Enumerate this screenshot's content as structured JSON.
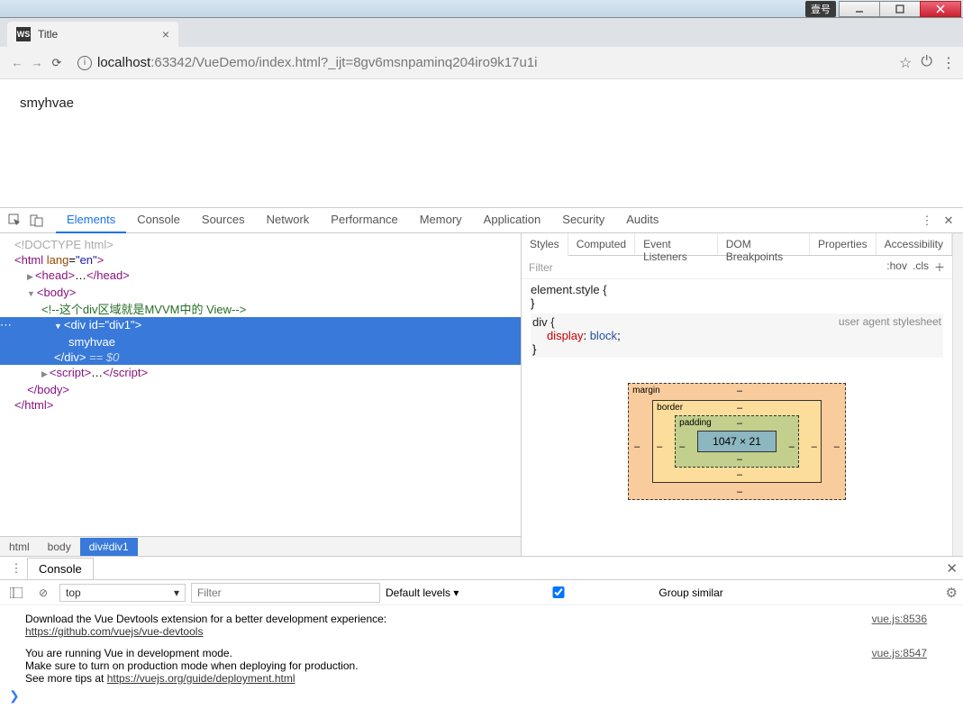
{
  "window": {
    "ime": "壹号"
  },
  "browser": {
    "tab": {
      "favicon": "WS",
      "title": "Title"
    },
    "url_host": "localhost",
    "url_rest": ":63342/VueDemo/index.html?_ijt=8gv6msnpaminq204iro9k17u1i"
  },
  "page_content": "smyhvae",
  "devtools": {
    "tabs": [
      "Elements",
      "Console",
      "Sources",
      "Network",
      "Performance",
      "Memory",
      "Application",
      "Security",
      "Audits"
    ],
    "dom": {
      "doctype": "<!DOCTYPE html>",
      "html_open": "html",
      "html_lang_attr": "lang",
      "html_lang_val": "\"en\"",
      "head": "head",
      "body": "body",
      "comment": "<!--这个div区域就是MVVM中的 View-->",
      "div_tag": "div",
      "div_id_attr": "id",
      "div_id_val": "\"div1\"",
      "div_text": "smyhvae",
      "eq": " == $0",
      "script": "script",
      "html_close": "html"
    },
    "crumbs": [
      "html",
      "body",
      "div#div1"
    ],
    "styles_tabs": [
      "Styles",
      "Computed",
      "Event Listeners",
      "DOM Breakpoints",
      "Properties",
      "Accessibility"
    ],
    "styles_filter": {
      "placeholder": "Filter",
      "hov": ":hov",
      "cls": ".cls"
    },
    "rules": {
      "elem": "element.style {",
      "div_sel": "div {",
      "ua": "user agent stylesheet",
      "disp_name": "display",
      "disp_val": "block"
    },
    "box": {
      "margin": "margin",
      "border": "border",
      "padding": "padding",
      "content": "1047 × 21",
      "dash": "‒"
    },
    "console": {
      "tab": "Console",
      "context": "top",
      "filter_placeholder": "Filter",
      "levels": "Default levels ▾",
      "group": "Group similar",
      "msg1": "Download the Vue Devtools extension for a better development experience:",
      "msg1_link": "https://github.com/vuejs/vue-devtools",
      "msg1_src": "vue.js:8536",
      "msg2a": "You are running Vue in development mode.",
      "msg2b": "Make sure to turn on production mode when deploying for production.",
      "msg2c": "See more tips at ",
      "msg2c_link": "https://vuejs.org/guide/deployment.html",
      "msg2_src": "vue.js:8547"
    }
  }
}
